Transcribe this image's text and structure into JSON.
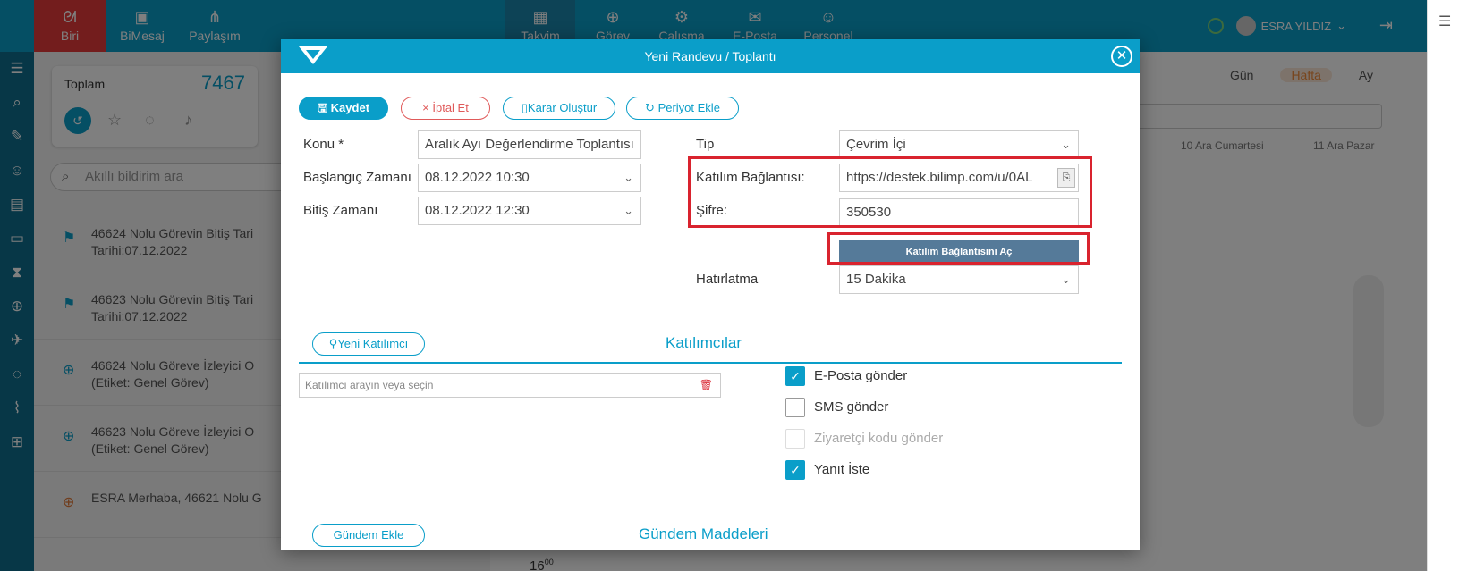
{
  "topbar": {
    "left_items": [
      {
        "label": "Biri",
        "icon": "rss-icon"
      },
      {
        "label": "BiMesaj",
        "icon": "chat-icon"
      },
      {
        "label": "Paylaşım",
        "icon": "share-icon"
      }
    ],
    "center_items": [
      {
        "label": "Takvim",
        "icon": "calendar-icon"
      },
      {
        "label": "Görev",
        "icon": "target-icon"
      },
      {
        "label": "Çalışma",
        "icon": "gear-icon"
      },
      {
        "label": "E-Posta",
        "icon": "mail-icon"
      },
      {
        "label": "Personel",
        "icon": "users-icon"
      }
    ],
    "user_name": "ESRA YILDIZ"
  },
  "leftpanel": {
    "total_label": "Toplam",
    "total_count": "7467",
    "search_placeholder": "Akıllı bildirim ara",
    "notifications": [
      {
        "line1": "46624 Nolu Görevin Bitiş Tari",
        "line2": "Tarihi:07.12.2022"
      },
      {
        "line1": "46623 Nolu Görevin Bitiş Tari",
        "line2": "Tarihi:07.12.2022"
      },
      {
        "line1": "46624 Nolu Göreve İzleyici O",
        "line2": "(Etiket: Genel Görev)"
      },
      {
        "line1": "46623 Nolu Göreve İzleyici O",
        "line2": "(Etiket: Genel Görev)"
      },
      {
        "line1": "ESRA Merhaba, 46621 Nolu G",
        "line2": ""
      }
    ]
  },
  "calendar": {
    "views": [
      "Gün",
      "Hafta",
      "Ay"
    ],
    "active_view": "Hafta",
    "day_headers": [
      "10 Ara Cumartesi",
      "11 Ara Pazar"
    ],
    "time_label": "16",
    "time_minutes": "00"
  },
  "modal": {
    "title": "Yeni Randevu / Toplantı",
    "buttons": {
      "save": "Kaydet",
      "cancel": "İptal Et",
      "decision": "Karar Oluştur",
      "period": "Periyot Ekle"
    },
    "fields": {
      "subject_label": "Konu *",
      "subject_value": "Aralık Ayı Değerlendirme Toplantısı",
      "start_label": "Başlangıç Zamanı",
      "start_value": "08.12.2022 10:30",
      "end_label": "Bitiş Zamanı",
      "end_value": "08.12.2022 12:30",
      "type_label": "Tip",
      "type_value": "Çevrim İçi",
      "link_label": "Katılım Bağlantısı:",
      "link_value": "https://destek.bilimp.com/u/0AL",
      "password_label": "Şifre:",
      "password_value": "350530",
      "open_link_button": "Katılım Bağlantısını Aç",
      "reminder_label": "Hatırlatma",
      "reminder_value": "15 Dakika"
    },
    "participants": {
      "new_button": "Yeni Katılımcı",
      "section_title": "Katılımcılar",
      "search_placeholder": "Katılımcı arayın veya seçin",
      "options": [
        {
          "label": "E-Posta gönder",
          "checked": true,
          "disabled": false
        },
        {
          "label": "SMS gönder",
          "checked": false,
          "disabled": false
        },
        {
          "label": "Ziyaretçi kodu gönder",
          "checked": false,
          "disabled": true
        },
        {
          "label": "Yanıt İste",
          "checked": true,
          "disabled": false
        }
      ]
    },
    "agenda": {
      "add_button": "Gündem Ekle",
      "section_title": "Gündem Maddeleri"
    }
  },
  "colors": {
    "primary": "#0a9ec9",
    "danger": "#d9232e",
    "open_link_bg": "#557a99"
  }
}
